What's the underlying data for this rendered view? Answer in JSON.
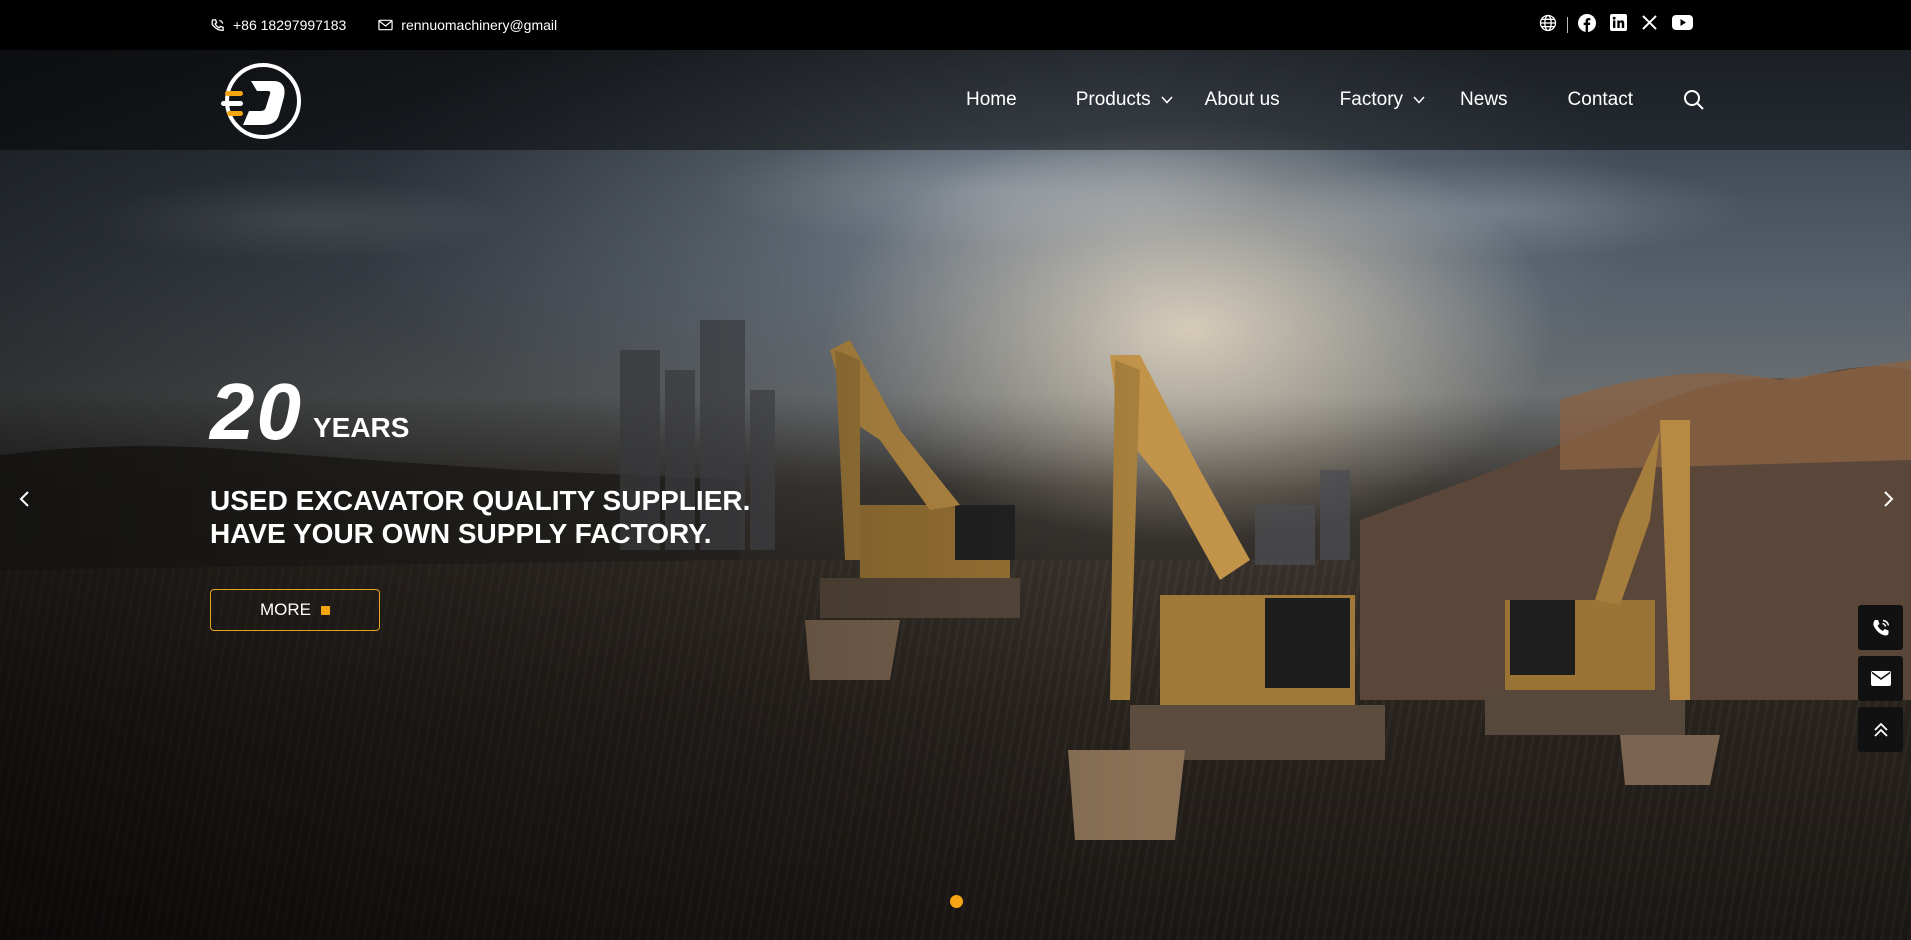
{
  "topbar": {
    "phone": "+86 18297997183",
    "email": "rennuomachinery@gmail",
    "icons": [
      "phone-icon",
      "mail-icon",
      "globe-icon",
      "facebook-icon",
      "linkedin-icon",
      "x-icon",
      "youtube-icon"
    ]
  },
  "nav": {
    "items": [
      {
        "label": "Home",
        "has_dropdown": false
      },
      {
        "label": "Products",
        "has_dropdown": true
      },
      {
        "label": "About us",
        "has_dropdown": false
      },
      {
        "label": "Factory",
        "has_dropdown": true
      },
      {
        "label": "News",
        "has_dropdown": false
      },
      {
        "label": "Contact",
        "has_dropdown": false
      }
    ]
  },
  "hero": {
    "years_number": "20",
    "years_unit": "YEARS",
    "headline_line1": "USED EXCAVATOR QUALITY SUPPLIER.",
    "headline_line2": "HAVE YOUR OWN SUPPLY FACTORY.",
    "button_label": "MORE",
    "slides_count": 1,
    "active_slide": 1
  },
  "side_buttons": [
    "phone-icon",
    "mail-icon",
    "back-to-top-icon"
  ],
  "colors": {
    "accent": "#f5a511",
    "button_border": "#e5a51f",
    "topbar_bg": "#000000",
    "text": "#ffffff"
  }
}
